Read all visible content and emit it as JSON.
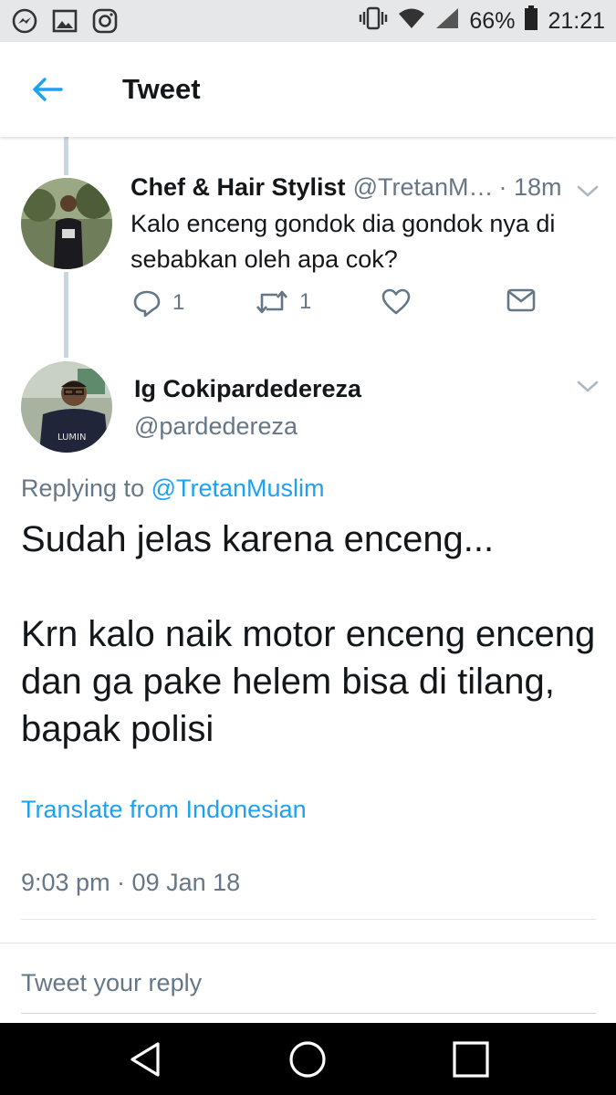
{
  "status_bar": {
    "left_icons": [
      "messenger-icon",
      "gallery-icon",
      "instagram-icon"
    ],
    "battery_percent": "66%",
    "time": "21:21"
  },
  "header": {
    "title": "Tweet",
    "back_icon": "back-arrow-icon"
  },
  "parent_tweet": {
    "name": "Chef & Hair Stylist",
    "handle": "@TretanM…",
    "time": "· 18m",
    "text": "Kalo enceng gondok dia gondok nya di sebabkan oleh apa cok?",
    "actions": {
      "reply_count": "1",
      "retweet_count": "1"
    }
  },
  "main_tweet": {
    "name": "Ig Cokipardedereza",
    "handle": "@pardedereza",
    "replying_prefix": "Replying to",
    "replying_to": "@TretanMuslim",
    "text_line1": "Sudah jelas karena enceng...",
    "text_line2": "Krn kalo naik motor enceng enceng dan ga pake helem bisa di tilang, bapak polisi",
    "translate": "Translate from Indonesian",
    "timestamp": "9:03 pm · 09 Jan 18"
  },
  "reply_input": {
    "placeholder": "Tweet your reply"
  },
  "colors": {
    "accent": "#1da1f2",
    "secondary_text": "#657786",
    "primary_text": "#14171a",
    "status_bar": "#e6e7e9",
    "nav_bar": "#000000"
  }
}
